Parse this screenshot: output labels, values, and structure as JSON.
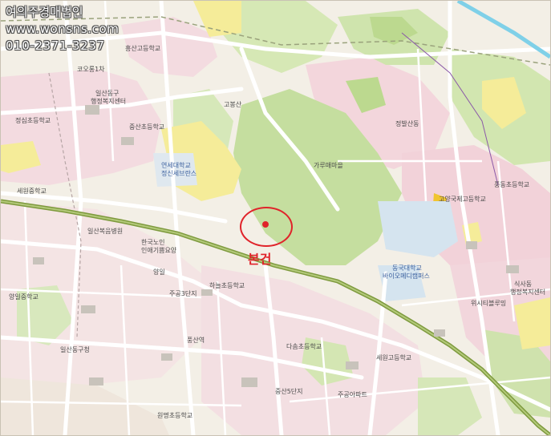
{
  "watermark": {
    "company": "여의주경매법인",
    "website": "www.wonsns.com",
    "phone": "010-2371-3237"
  },
  "subject": {
    "label": "본건"
  },
  "place_labels": [
    "흥산고등학교",
    "코오롱1차",
    "일산동구",
    "행정복지센터",
    "중산초등학교",
    "연세대학교",
    "정신세브란스",
    "일산복음병원",
    "한국노인",
    "인애기쁨요양",
    "양일",
    "주공3단지",
    "하늘초등학교",
    "풍산역",
    "일산동구청",
    "다솜초등학교",
    "세원고등학교",
    "동국대학교",
    "바이오메디캠퍼스",
    "위시티블루밍",
    "고양국제고등학교",
    "식사동",
    "행정복지센터",
    "풍동초등학교",
    "가루매마을",
    "정발산동",
    "고봉산",
    "정심초등학교",
    "세원중학교",
    "양일중학교",
    "주공아파트",
    "중산5단지",
    "원명초등학교"
  ],
  "colors": {
    "rail": "#8aa64a",
    "forest": "#c2dc9b",
    "urban": "#f3d7dc",
    "industrial": "#f6ef9a",
    "road": "#ffffff",
    "water": "#7fd0e8",
    "marker": "#e0232a"
  }
}
